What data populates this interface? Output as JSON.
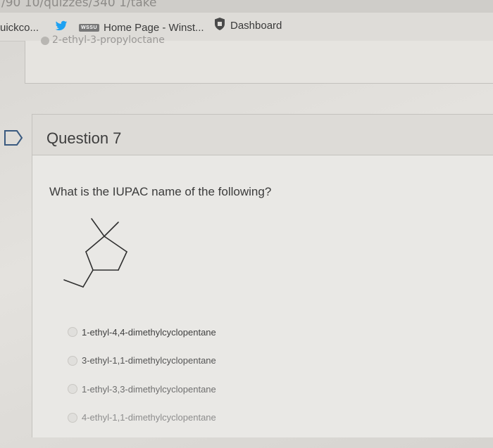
{
  "browser": {
    "url_fragment": "/90 10/quizzes/340 1/take",
    "bookmarks": [
      {
        "label": "uickco..."
      },
      {
        "label": "",
        "icon": "twitter-bird-icon"
      },
      {
        "label": "Home Page - Winst...",
        "badge": "WSSU"
      },
      {
        "label": "Dashboard",
        "icon": "shield-icon"
      }
    ]
  },
  "previous_question": {
    "answer_fragment": "2-ethyl-3-propyloctane"
  },
  "question": {
    "title": "Question 7",
    "prompt": "What is the IUPAC name of the following?",
    "structure_icon": "skeletal-structure-ethyl-dimethylcyclopentane",
    "options": [
      {
        "label": "1-ethyl-4,4-dimethylcyclopentane",
        "selected": false,
        "color": "#3f3f3f"
      },
      {
        "label": "3-ethyl-1,1-dimethylcyclopentane",
        "selected": false,
        "color": "#555555"
      },
      {
        "label": "1-ethyl-3,3-dimethylcyclopentane",
        "selected": false,
        "color": "#6f6f6f"
      },
      {
        "label": "4-ethyl-1,1-dimethylcyclopentane",
        "selected": false,
        "color": "#8d8d8d"
      }
    ]
  },
  "colors": {
    "flag_accent": "#3a5a80",
    "twitter_blue": "#1da1f2"
  }
}
